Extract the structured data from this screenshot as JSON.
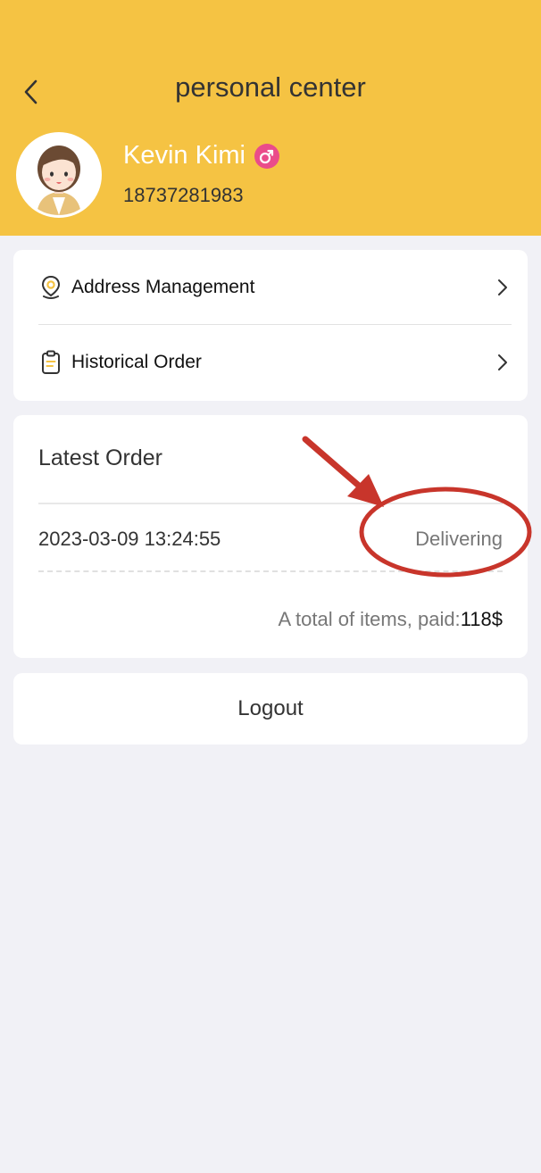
{
  "header": {
    "title": "personal center",
    "back_icon": "chevron-left-icon"
  },
  "user": {
    "name": "Kevin Kimi",
    "gender_icon": "male-gender-icon",
    "phone": "18737281983"
  },
  "menu": {
    "items": [
      {
        "label": "Address Management",
        "icon": "location-pin-icon"
      },
      {
        "label": "Historical Order",
        "icon": "clipboard-icon"
      }
    ]
  },
  "latest_order": {
    "title": "Latest Order",
    "time": "2023-03-09 13:24:55",
    "status": "Delivering",
    "total_label": "A total of items, paid:",
    "total_amount": "118$"
  },
  "logout": {
    "label": "Logout"
  },
  "colors": {
    "header_bg": "#f5c343",
    "page_bg": "#f1f1f6",
    "gender_icon": "#ea4c8a",
    "annotation": "#c8352b"
  }
}
